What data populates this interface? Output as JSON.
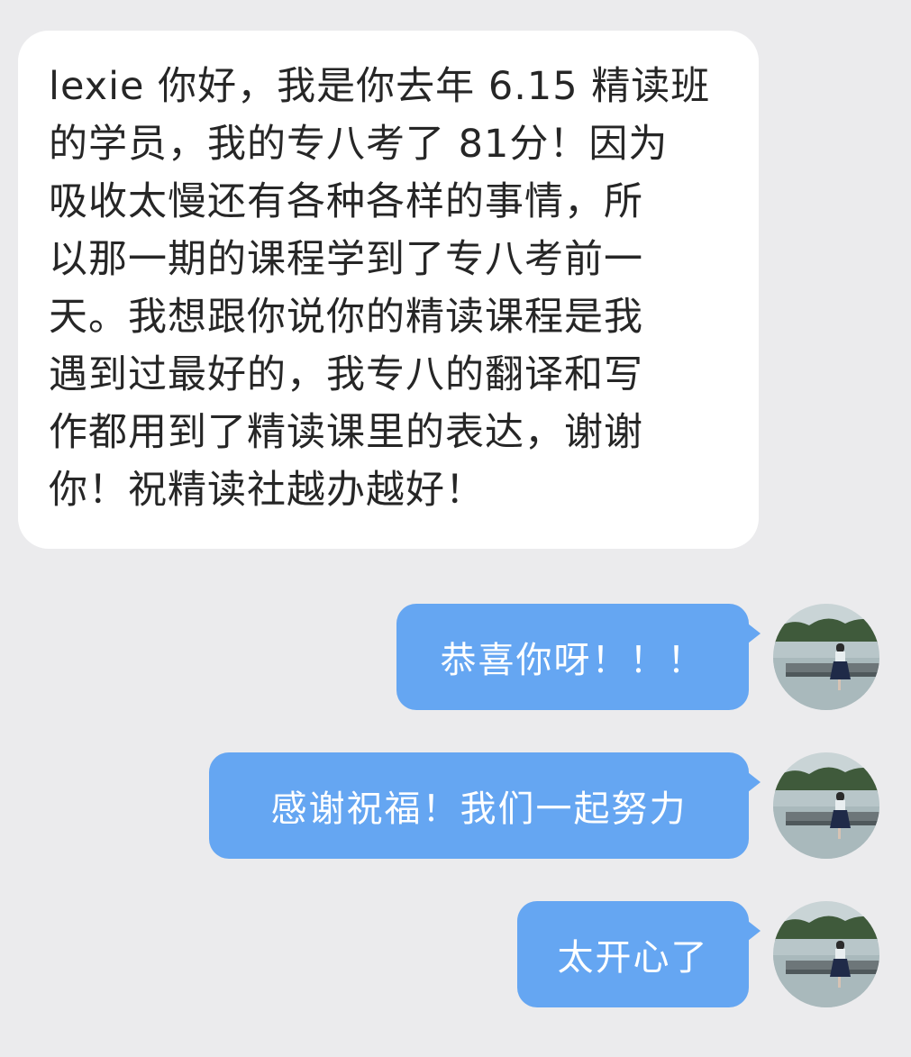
{
  "incoming_message": {
    "lines": [
      "lexie 你好，我是你去年 6.15 精读班",
      "的学员，我的专八考了 81分！因为",
      "吸收太慢还有各种各样的事情，所",
      "以那一期的课程学到了专八考前一",
      "天。我想跟你说你的精读课程是我",
      "遇到过最好的，我专八的翻译和写",
      "作都用到了精读课里的表达，谢谢",
      "你！祝精读社越办越好！"
    ]
  },
  "outgoing_messages": [
    {
      "text": "恭喜你呀！！！"
    },
    {
      "text": "感谢祝福！我们一起努力"
    },
    {
      "text": "太开心了"
    }
  ],
  "colors": {
    "background": "#ebebed",
    "incoming_bubble": "#ffffff",
    "outgoing_bubble": "#65a6f2",
    "incoming_text": "#262626",
    "outgoing_text": "#ffffff"
  },
  "avatar": {
    "icon": "user-avatar-photo-lake-pier"
  }
}
